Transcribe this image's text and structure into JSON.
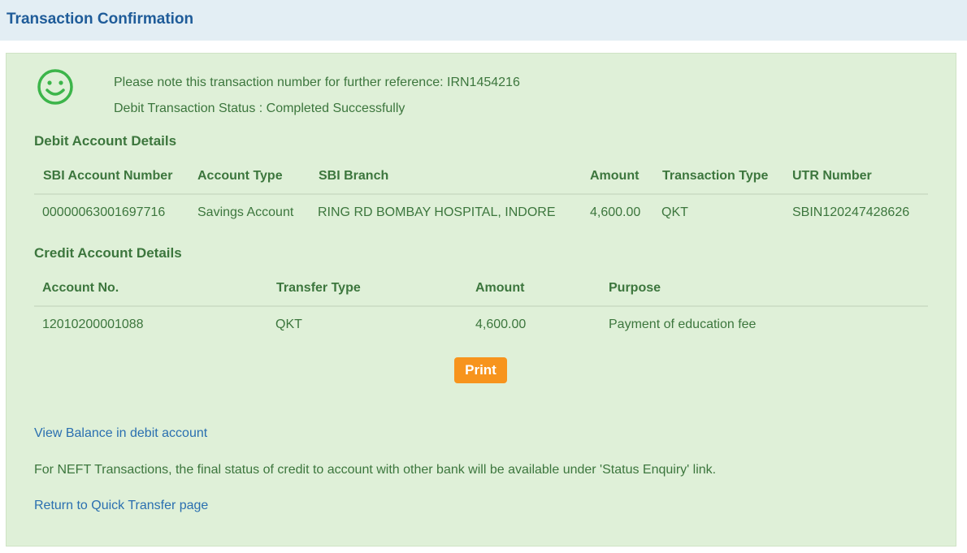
{
  "header": {
    "title": "Transaction Confirmation"
  },
  "status": {
    "icon": "smiley-icon",
    "reference_note": "Please note this transaction number for further reference: IRN1454216",
    "debit_status": "Debit Transaction Status : Completed Successfully"
  },
  "debit": {
    "title": "Debit Account Details",
    "columns": [
      "SBI Account Number",
      "Account Type",
      "SBI Branch",
      "Amount",
      "Transaction Type",
      "UTR Number"
    ],
    "row": [
      "00000063001697716",
      "Savings Account",
      "RING RD BOMBAY HOSPITAL, INDORE",
      "4,600.00",
      "QKT",
      "SBIN120247428626"
    ]
  },
  "credit": {
    "title": "Credit Account Details",
    "columns": [
      "Account No.",
      "Transfer Type",
      "Amount",
      "Purpose"
    ],
    "row": [
      "12010200001088",
      "QKT",
      "4,600.00",
      "Payment of education fee"
    ]
  },
  "actions": {
    "print_label": "Print"
  },
  "links": {
    "view_balance": "View Balance in debit account",
    "neft_info": "For NEFT Transactions, the final status of credit to account with other bank will be available under 'Status Enquiry' link.",
    "return_quick_transfer": "Return to Quick Transfer page"
  },
  "colors": {
    "header_bg": "#e3eef4",
    "header_text": "#1f5c99",
    "panel_bg": "#dff0d8",
    "text_green": "#3c763d",
    "link_blue": "#2a6fb0",
    "button_orange": "#f7941d"
  }
}
